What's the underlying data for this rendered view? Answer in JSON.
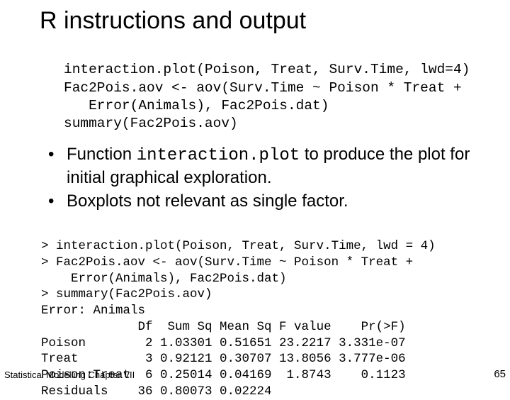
{
  "title": "R instructions and output",
  "code": {
    "line1": "interaction.plot(Poison, Treat, Surv.Time, lwd=4)",
    "line2": "Fac2Pois.aov <- aov(Surv.Time ~ Poison * Treat + ",
    "line3": "   Error(Animals), Fac2Pois.dat)",
    "line4": "summary(Fac2Pois.aov)"
  },
  "bullets": {
    "b1_pre": "Function ",
    "b1_code": "interaction.plot",
    "b1_post": " to produce the plot for initial graphical exploration.",
    "b2": "Boxplots not relevant as single factor."
  },
  "output": {
    "l1": "> interaction.plot(Poison, Treat, Surv.Time, lwd = 4)",
    "l2": "> Fac2Pois.aov <- aov(Surv.Time ~ Poison * Treat + ",
    "l3": "    Error(Animals), Fac2Pois.dat)",
    "l4": "> summary(Fac2Pois.aov)",
    "l5": "Error: Animals",
    "l6": "             Df  Sum Sq Mean Sq F value    Pr(>F)",
    "l7": "Poison        2 1.03301 0.51651 23.2217 3.331e-07",
    "l8": "Treat         3 0.92121 0.30707 13.8056 3.777e-06",
    "l9": "Poison:Treat  6 0.25014 0.04169  1.8743    0.1123",
    "l10": "Residuals    36 0.80073 0.02224"
  },
  "footer": {
    "left": "Statistical Modelling   Chapter VII",
    "right": "65"
  }
}
